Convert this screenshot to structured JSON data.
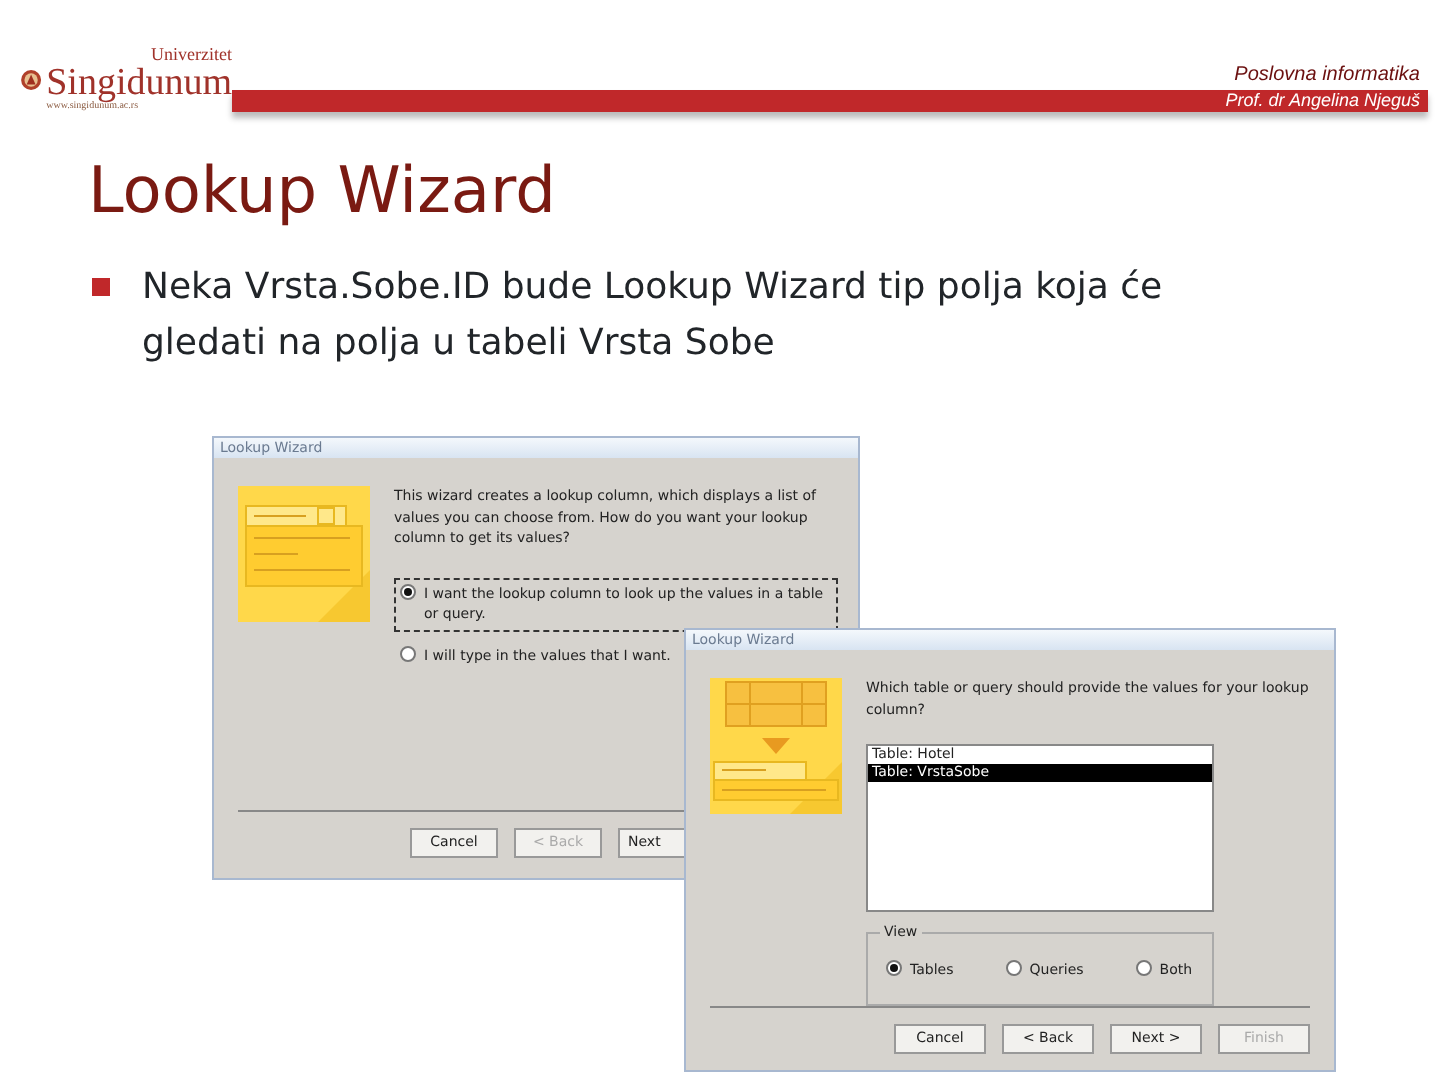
{
  "header": {
    "logo_top": "Univerzitet",
    "logo_name": "Singidunum",
    "logo_url": "www.singidunum.ac.rs",
    "course": "Poslovna informatika",
    "author": "Prof. dr Angelina Njeguš"
  },
  "title": "Lookup Wizard",
  "bullets": [
    "Neka Vrsta.Sobe.ID bude Lookup Wizard tip polja koja će gledati na polja u tabeli Vrsta Sobe"
  ],
  "dialogs": [
    {
      "kind": "combo",
      "title": "Lookup Wizard",
      "prompt": "This wizard creates a lookup column, which displays a list of values you can choose from. How do you want your lookup column to get its values?",
      "options": [
        {
          "label": "I want the lookup column to look up the values in a table or query.",
          "selected": true
        },
        {
          "label": "I will type in the values that I want.",
          "selected": false
        }
      ],
      "buttons": [
        {
          "label": "Cancel",
          "disabled": false
        },
        {
          "label": "< Back",
          "disabled": true
        },
        {
          "label": "Next",
          "disabled": false
        }
      ]
    },
    {
      "kind": "table",
      "title": "Lookup Wizard",
      "prompt": "Which table or query should provide the values for your lookup column?",
      "list": [
        {
          "label": "Table: Hotel",
          "selected": false
        },
        {
          "label": "Table: VrstaSobe",
          "selected": true
        }
      ],
      "group": "View",
      "options": [
        {
          "label": "Tables",
          "selected": true
        },
        {
          "label": "Queries",
          "selected": false
        },
        {
          "label": "Both",
          "selected": false
        }
      ],
      "buttons": [
        {
          "label": "Cancel",
          "disabled": false
        },
        {
          "label": "< Back",
          "disabled": false
        },
        {
          "label": "Next >",
          "disabled": false
        },
        {
          "label": "Finish",
          "disabled": true
        }
      ]
    }
  ]
}
